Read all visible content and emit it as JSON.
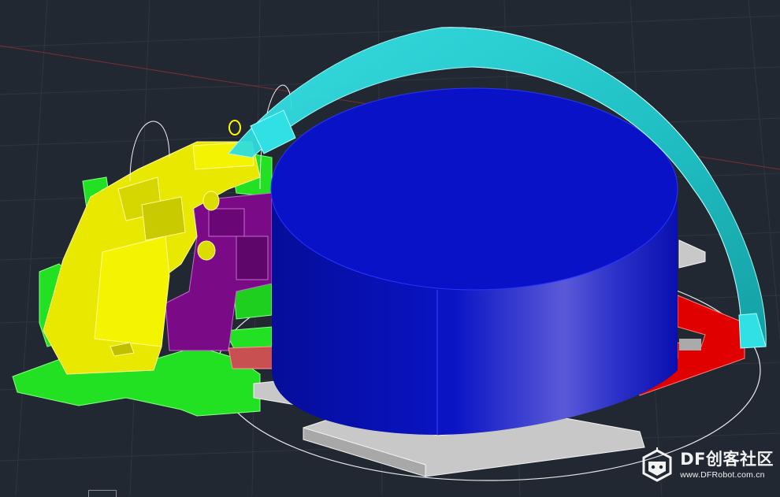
{
  "viewport": {
    "background": "#222831",
    "grid_color": "#2f3640",
    "axis_color": "#7a2f2f",
    "objects": [
      {
        "name": "cylinder-body",
        "color": "#0a12c8"
      },
      {
        "name": "dome-shell",
        "color": "#22d0d4"
      },
      {
        "name": "yellow-bracket",
        "color": "#f4f400"
      },
      {
        "name": "green-base",
        "color": "#22e022"
      },
      {
        "name": "purple-gearbox",
        "color": "#7a0a86"
      },
      {
        "name": "red-plate",
        "color": "#e00000"
      },
      {
        "name": "gray-plate",
        "color": "#c8c8c8"
      }
    ]
  },
  "watermark": {
    "title": "DF创客社区",
    "url": "www.DFRobot.com.cn",
    "icon": "robot-logo-icon"
  },
  "ucs_icon": "ucs-icon"
}
